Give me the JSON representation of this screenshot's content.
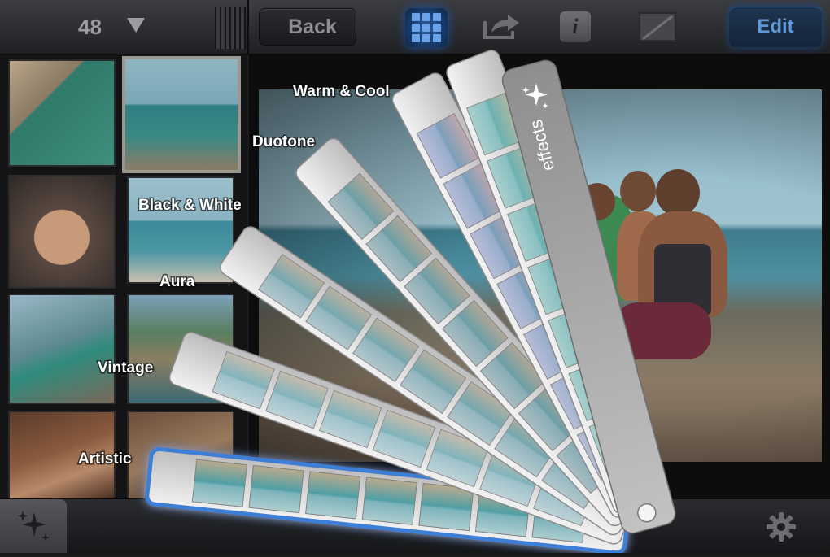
{
  "toolbar": {
    "photo_count": "48",
    "back_label": "Back",
    "edit_label": "Edit",
    "info_glyph": "i"
  },
  "icons": {
    "count_menu": "chevron-down-icon",
    "grid": "grid-icon",
    "share": "share-icon",
    "info": "info-icon",
    "crop": "crop-icon",
    "effects": "sparkle-icon",
    "settings": "gear-icon"
  },
  "effects_fan": {
    "handle_label": "effects",
    "strips": [
      {
        "label": "Artistic",
        "selected": true
      },
      {
        "label": "Vintage",
        "selected": false
      },
      {
        "label": "Aura",
        "selected": false
      },
      {
        "label": "Black & White",
        "selected": false
      },
      {
        "label": "Duotone",
        "selected": false
      },
      {
        "label": "Warm & Cool",
        "selected": false
      }
    ]
  },
  "colors": {
    "accent_blue": "#3c7fd6",
    "toolbar_top": "#3c3d40",
    "toolbar_bottom": "#1f2022",
    "strip_body": "#d6d6d6",
    "handle": "#a9a9a9"
  }
}
